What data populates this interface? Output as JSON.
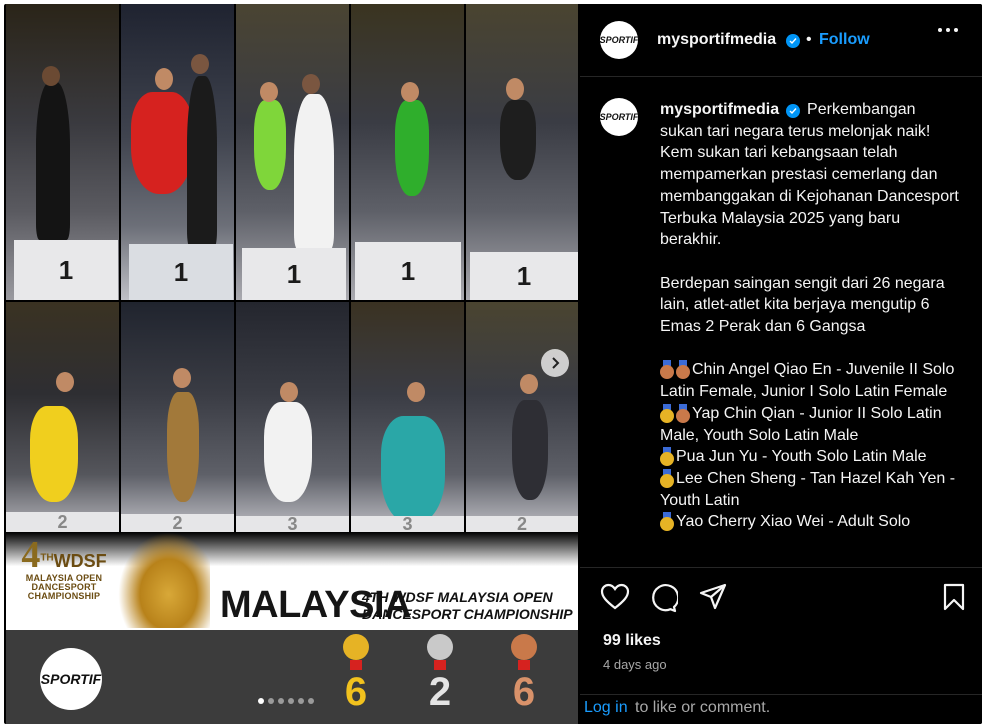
{
  "post": {
    "username": "mysportifmedia",
    "separator": "•",
    "follow_label": "Follow",
    "caption_lines": [
      "Perkembangan sukan tari negara terus melonjak naik! Kem sukan tari kebangsaan telah mempamerkan prestasi cemerlang dan membanggakan di Kejohanan Dancesport Terbuka Malaysia 2025 yang baru berakhir.",
      "Berdepan saingan sengit dari 26 negara lain, atlet-atlet kita berjaya mengutip 6 Emas 2 Perak dan 6 Gangsa"
    ],
    "winners": [
      {
        "medals": [
          "bronze",
          "bronze"
        ],
        "text": "Chin Angel Qiao En - Juvenile II Solo Latin Female, Junior I Solo Latin Female"
      },
      {
        "medals": [
          "gold",
          "bronze"
        ],
        "text": "Yap Chin Qian - Junior II Solo Latin Male, Youth Solo Latin Male"
      },
      {
        "medals": [
          "gold"
        ],
        "text": "Pua Jun Yu - Youth Solo Latin Male"
      },
      {
        "medals": [
          "gold"
        ],
        "text": "Lee Chen Sheng - Tan Hazel Kah Yen - Youth Latin"
      },
      {
        "medals": [
          "gold"
        ],
        "text": "Yao Cherry Xiao Wei - Adult Solo"
      }
    ],
    "likes": "99 likes",
    "time_ago": "4 days ago",
    "login_link": "Log in",
    "login_rest": "to like or comment."
  },
  "media": {
    "banner_number": "4",
    "banner_sup": "TH",
    "banner_org": "WDSF",
    "banner_lines": [
      "MALAYSIA OPEN",
      "DANCESPORT",
      "CHAMPIONSHIP"
    ],
    "banner_title": "MALAYSIA",
    "banner_subtitle": [
      "4TH WDSF MALAYSIA OPEN",
      "DANCESPORT CHAMPIONSHIP"
    ],
    "brand": "SPORTIF",
    "medal_counts": {
      "gold": "6",
      "silver": "2",
      "bronze": "6"
    },
    "podium_top": [
      "1",
      "1",
      "1",
      "1",
      "1"
    ],
    "podium_bottom": [
      "2",
      "2",
      "3",
      "3",
      "2"
    ],
    "carousel_total": 6,
    "carousel_active": 0
  },
  "colors": {
    "gold": "#e6b325",
    "silver": "#c9c9c9",
    "bronze": "#c9794a",
    "link": "#1a9dff",
    "verified": "#0095f6"
  }
}
